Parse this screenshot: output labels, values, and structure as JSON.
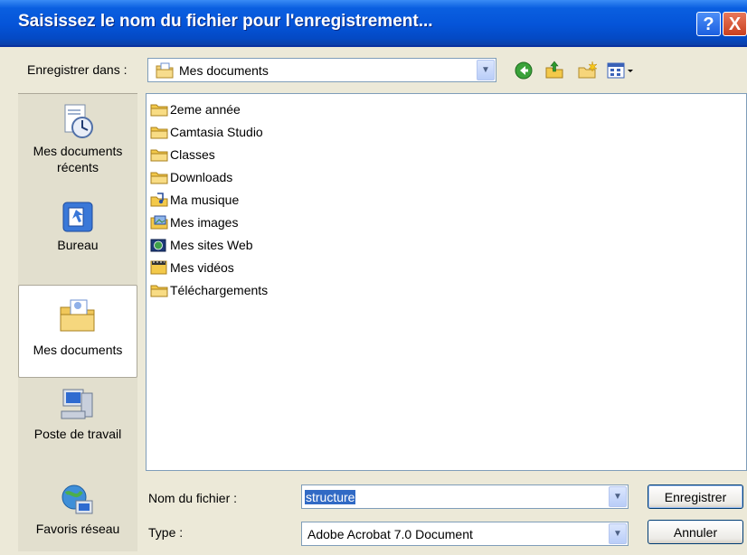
{
  "window": {
    "title": "Saisissez le nom du fichier pour l'enregistrement...",
    "help_glyph": "?",
    "close_glyph": "X"
  },
  "save_in": {
    "label": "Enregistrer dans :",
    "value": "Mes documents"
  },
  "toolbar": {
    "icons": [
      "back-icon",
      "up-folder-icon",
      "new-folder-icon",
      "view-menu-icon"
    ]
  },
  "places": [
    {
      "label_line1": "Mes documents",
      "label_line2": "récents",
      "icon": "recent-documents-icon"
    },
    {
      "label_line1": "Bureau",
      "label_line2": "",
      "icon": "desktop-icon"
    },
    {
      "label_line1": "Mes documents",
      "label_line2": "",
      "icon": "my-documents-icon"
    },
    {
      "label_line1": "Poste de travail",
      "label_line2": "",
      "icon": "my-computer-icon"
    },
    {
      "label_line1": "Favoris réseau",
      "label_line2": "",
      "icon": "network-places-icon"
    }
  ],
  "files": [
    {
      "name": "2eme année",
      "icon": "folder-icon"
    },
    {
      "name": "Camtasia Studio",
      "icon": "folder-icon"
    },
    {
      "name": "Classes",
      "icon": "folder-icon"
    },
    {
      "name": "Downloads",
      "icon": "folder-icon"
    },
    {
      "name": "Ma musique",
      "icon": "music-folder-icon"
    },
    {
      "name": "Mes images",
      "icon": "pictures-folder-icon"
    },
    {
      "name": "Mes sites Web",
      "icon": "web-folder-icon"
    },
    {
      "name": "Mes vidéos",
      "icon": "video-folder-icon"
    },
    {
      "name": "Téléchargements",
      "icon": "folder-icon"
    }
  ],
  "filename": {
    "label": "Nom du fichier :",
    "value": "structure"
  },
  "filetype": {
    "label": "Type :",
    "value": "Adobe Acrobat 7.0 Document"
  },
  "buttons": {
    "save": "Enregistrer",
    "cancel": "Annuler"
  },
  "colors": {
    "titlebar": "#0554d8",
    "selection": "#316ac5",
    "dialog_bg": "#ece9d8"
  }
}
